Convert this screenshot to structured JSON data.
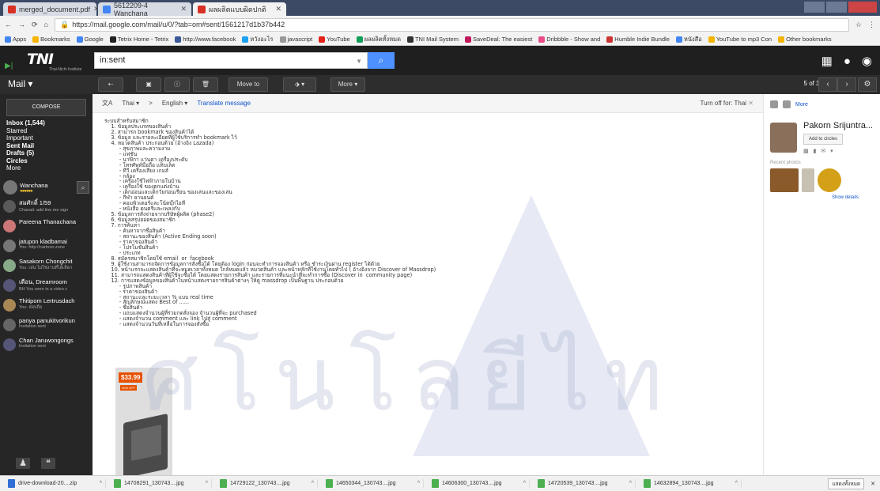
{
  "browser": {
    "tabs": [
      {
        "title": "merged_document.pdf",
        "color": "#d93025"
      },
      {
        "title": "5612209-4 Wanchana",
        "color": "#4285f4"
      },
      {
        "title": "ผลผลิตแบบผิดปกติ",
        "color": "#d93025"
      }
    ],
    "url": "https://mail.google.com/mail/u/0/?tab=om#sent/1561217d1b37b442",
    "bookmarks": [
      {
        "label": "Apps",
        "color": "#4285f4"
      },
      {
        "label": "Bookmarks",
        "color": "#f4b400"
      },
      {
        "label": "Google",
        "color": "#4285f4"
      },
      {
        "label": "Tetrix Home - Tetrix",
        "color": "#222222"
      },
      {
        "label": "http://www.facebook",
        "color": "#3b5998"
      },
      {
        "label": "หวังอะไร",
        "color": "#1da1f2"
      },
      {
        "label": "javascript",
        "color": "#999999"
      },
      {
        "label": "YouTube",
        "color": "#e62117"
      },
      {
        "label": "ผลผลิตทั้งหมด",
        "color": "#0f9d58"
      },
      {
        "label": "TNI Mail System",
        "color": "#333333"
      },
      {
        "label": "SaveDeal: The easiest",
        "color": "#c2185b"
      },
      {
        "label": "Dribbble - Show and",
        "color": "#ea4c89"
      },
      {
        "label": "Humble Indie Bundle",
        "color": "#cc3333"
      },
      {
        "label": "หนังสือ",
        "color": "#4285f4"
      },
      {
        "label": "YouTube to mp3 Con",
        "color": "#f4b400"
      },
      {
        "label": "Other bookmarks",
        "color": "#f4b400"
      }
    ]
  },
  "gmail": {
    "logo": "TNI",
    "logo_tag": "Thai-Nichi Institute",
    "search_value": "in:sent",
    "mail_label": "Mail",
    "toolbar": {
      "move_inbox": "Move to Inbox",
      "more": "More",
      "pager": "5 of 36"
    },
    "compose": "COMPOSE",
    "folders": [
      {
        "label": "Inbox (1,544)",
        "bold": true
      },
      {
        "label": "Starred"
      },
      {
        "label": "Important"
      },
      {
        "label": "Sent Mail",
        "bold": true
      },
      {
        "label": "Drafts (5)",
        "bold": true
      },
      {
        "label": "Circles",
        "bold": true
      },
      {
        "label": "More"
      }
    ],
    "me": "Wanchana",
    "contacts": [
      {
        "name": "สมศักดิ์ 1/59",
        "status": "Chanati: add line me sign"
      },
      {
        "name": "Pareena Thanachana",
        "status": ""
      },
      {
        "name": "jatupon kladbamai",
        "status": "You: http://cartoon.zone"
      },
      {
        "name": "Sasakorn Chongchit",
        "status": "You: เล่น ไม่ใช่งานที่ได้เลือก"
      },
      {
        "name": "เดือน, Dreamroom",
        "status": "BH You were in a video c"
      },
      {
        "name": "Thitipom Lertrusdach",
        "status": "You: สอบถือ"
      },
      {
        "name": "panya panukitvorikun",
        "status": "Invitation sent"
      },
      {
        "name": "Chan Jaruwongongs",
        "status": "Invitation sent"
      }
    ]
  },
  "translate": {
    "source": "Thai",
    "arrow": ">",
    "target": "English",
    "link": "Translate message",
    "off": "Turn off for: Thai"
  },
  "email_body": "ระบบสำหรับสมาชิก\n    1. ข้อมูลประเภทของสินค้า\n    2. สามารถ bookmark ของสินค้าได้\n    3. ข้อมูล และรายละเอียดที่ผู้ใช้บริการทำ bookmark ไว้\n    4. หมวดสินค้า ประกอบด้วย (อ้างอิง Lazada)\n         - สุขภาพและความงาม\n         - แฟชั่น\n         - นาฬิกา แว่นตา เครื่องประดับ\n         - โทรศัพท์มือถือ แท็บเล็ต\n         - ทีวี เครื่องเสียง เกมส์\n         - กล้อง\n         - เครื่องใช้ไฟฟ้าภายในบ้าน\n         - เครื่องใช้ ของตกแต่งบ้าน\n         - เด็กอ่อนและเด็กวัยก่อนเรียน ของเล่นและของเล่น\n         - กีฬา ยานยนต์\n         - คอมพิวเตอร์และโน้ตบุ๊กไอที\n         - หนังสือ ดนตรีและเพลงกับ\n    5. ข้อมูลการสั่งจ่ายจากบริษัทผู้ผลิต (phase2)\n    6. ข้อมูลสรุปยอดของสมาชิก\n    7. การค้นหา\n         - ค้นหาจากชื่อสินค้า\n         - สถานะของสินค้า (Active Ending soon)\n         - ราคาของสินค้า\n         - โปรโมชั่นสินค้า\n         - ประเภท\n    8. สมัครสมาชิกโดยใช้ email  or  facebook\n    9. ผู้ใช้งานสามารถจัดการข้อมูลการสั่งซื้อได้ โดยต้อง login ก่อนจะทำการจองสินค้า หรือ ชำระเงินผ่าน register ได้ด้วย\n    10. หน้าแรกจะแสดงสินค้าที่จะหมดเวลาทั้งหมด ใกล้หมดแล้ว หมวดสินค้า และหน้าหลักที่ใช้งานโดยทั่วไป ( อ้างอิงจาก Discover of Massdrop)\n    11. สามารถแสดงสินค้าที่ผู้ใช้จะซื้อได้ โดยแสดงรายการสินค้า และรายการที่แนะนำที่จะทำการซื้อ (Discover in  community page)\n    12. การแสดงข้อมูลของสินค้าในหน้าแสดงรายการสินค้าต่างๆ ให้ดู massdrop เป็นพื้นฐาน ประกอบด้วย\n         - รูปภาพสินค้า\n         - ราคาของสินค้า\n         - สถานะและระยะเวลา % แบบ real time\n         - สัญลักษณ์แสดง Best of ......\n         - ชื่อสินค้า\n         - แถบแสดงจำนวนผู้ที่ร่วมกดสั่งจอง จำนวนผู้ที่จะ purchased\n         - แสดงจำนวน comment และ link ไปสู่ comment\n         - แสดงจำนวนวันที่เหลือในการจองสั่งซื้อ",
  "product": {
    "price": "$33.99",
    "sub": "40% OFF"
  },
  "right_pane": {
    "more": "More",
    "name": "Pakorn Srijuntra...",
    "add_circles": "Add to circles",
    "recent_photos": "Recent photos",
    "show_details": "Show details",
    "photo_colors": [
      "#8a5a2a",
      "#c8c0b0",
      "#d4a017"
    ]
  },
  "watermark": "ศโนโลยีไท",
  "downloads": [
    {
      "name": "drive-download-20....zip",
      "kind": "drive"
    },
    {
      "name": "14708291_130743....jpg",
      "kind": "img"
    },
    {
      "name": "14729122_130743....jpg",
      "kind": "img"
    },
    {
      "name": "14650344_130743....jpg",
      "kind": "img"
    },
    {
      "name": "14606300_130743....jpg",
      "kind": "img"
    },
    {
      "name": "14720539_130743....jpg",
      "kind": "img"
    },
    {
      "name": "14632894_130743....jpg",
      "kind": "img"
    }
  ],
  "show_all_downloads": "แสดงทั้งหมด"
}
